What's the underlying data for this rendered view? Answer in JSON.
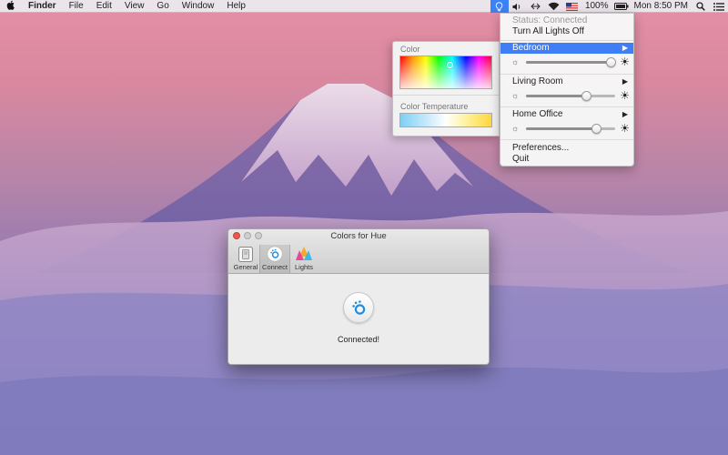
{
  "menubar": {
    "apple_icon": "apple-logo-icon",
    "app_name": "Finder",
    "items": [
      "File",
      "Edit",
      "View",
      "Go",
      "Window",
      "Help"
    ],
    "battery": "100%",
    "clock": "Mon 8:50 PM"
  },
  "menu": {
    "status": "Status: Connected",
    "lights_off": "Turn All Lights Off",
    "rooms": [
      {
        "name": "Bedroom",
        "brightness": 0.95
      },
      {
        "name": "Living Room",
        "brightness": 0.67
      },
      {
        "name": "Home Office",
        "brightness": 0.79
      }
    ],
    "preferences": "Preferences...",
    "quit": "Quit"
  },
  "color_panel": {
    "color_label": "Color",
    "temp_label": "Color Temperature",
    "selected_hue": 0.54,
    "selected_saturation": 0.25
  },
  "window": {
    "title": "Colors for Hue",
    "tabs": [
      "General",
      "Connect",
      "Lights"
    ],
    "status": "Connected!"
  },
  "colors": {
    "accent": "#3f7ef4",
    "connected_blue": "#1e8fe0"
  }
}
